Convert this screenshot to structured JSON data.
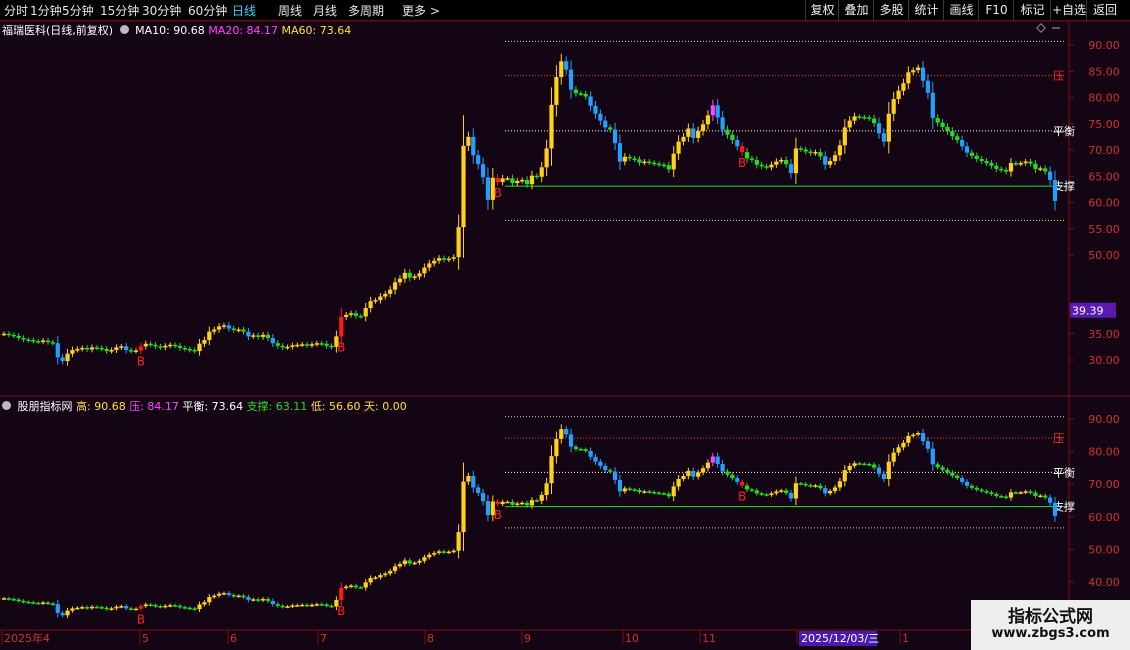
{
  "toolbar": {
    "periods": [
      "分时",
      "1分钟",
      "5分钟",
      "15分钟",
      "30分钟",
      "60分钟",
      "日线",
      "周线",
      "月线",
      "多周期",
      "更多 >"
    ],
    "active_period": "日线",
    "right_buttons": [
      "复权",
      "叠加",
      "多股",
      "统计",
      "画线",
      "F10",
      "标记",
      "+自选",
      "返回"
    ]
  },
  "main_panel": {
    "stock_name": "福瑞医科",
    "chart_desc": "(日线,前复权)",
    "ma10_label": "MA10: 90.68",
    "ma20_label": "MA20: 84.17",
    "ma60_label": "MA60: 73.64",
    "y_ticks": [
      "90.00",
      "85.00",
      "80.00",
      "75.00",
      "70.00",
      "65.00",
      "60.00",
      "55.00",
      "50.00",
      "35.00",
      "30.00"
    ],
    "price_tag": "39.39",
    "line_labels": {
      "pressure": "压",
      "balance": "平衡",
      "support": "支撑"
    },
    "signal_label": "B"
  },
  "sub_panel": {
    "name": "股朋指标网",
    "high_label": "高: 90.68",
    "pressure_label": "压: 84.17",
    "balance_label": "平衡: 73.64",
    "support_label": "支撑: 63.11",
    "low_label": "低: 56.60",
    "days_label": "天: 0.00",
    "y_ticks": [
      "90.00",
      "80.00",
      "70.00",
      "60.00",
      "50.00",
      "40.00"
    ]
  },
  "x_axis": {
    "labels": [
      "2025年4",
      "5",
      "6",
      "7",
      "8",
      "9",
      "10",
      "11",
      "1",
      "1"
    ],
    "cursor_date": "2025/12/03/三"
  },
  "watermark": {
    "line1": "指标公式网",
    "line2": "www.zbgs3.com"
  },
  "colors": {
    "up": "#ffd11a",
    "down": "#22dd22",
    "blue": "#22a0ff",
    "magenta": "#ff44ff",
    "red": "#ff1a1a",
    "bg": "#140514",
    "axis": "#7a1010"
  },
  "chart_data": {
    "type": "candlestick",
    "title": "福瑞医科 (日线,前复权)",
    "ylim_main": [
      26,
      92
    ],
    "ylim_sub": [
      36,
      92
    ],
    "levels": {
      "high": 90.68,
      "pressure": 84.17,
      "balance": 73.64,
      "support": 63.11,
      "low": 56.6
    },
    "closes": [
      35.0,
      34.8,
      34.6,
      34.2,
      33.9,
      33.8,
      33.6,
      33.5,
      33.7,
      33.4,
      33.2,
      30.5,
      29.8,
      31.2,
      31.9,
      32.1,
      32.3,
      32.0,
      32.4,
      32.3,
      32.1,
      31.7,
      31.9,
      32.4,
      32.6,
      31.9,
      31.7,
      31.8,
      32.6,
      33.1,
      32.9,
      32.6,
      32.4,
      32.7,
      32.9,
      32.7,
      32.3,
      32.1,
      31.9,
      31.7,
      33.1,
      33.8,
      35.4,
      35.8,
      36.4,
      36.6,
      36.0,
      35.7,
      35.8,
      35.4,
      34.5,
      34.7,
      34.4,
      34.8,
      34.2,
      33.2,
      32.7,
      32.4,
      32.5,
      32.8,
      32.9,
      33.0,
      32.8,
      33.0,
      33.2,
      33.1,
      32.7,
      32.5,
      34.5,
      38.2,
      38.6,
      38.9,
      38.4,
      38.3,
      39.9,
      41.2,
      41.4,
      42.1,
      42.6,
      43.4,
      44.8,
      45.5,
      46.6,
      45.7,
      45.9,
      46.5,
      47.6,
      48.4,
      48.9,
      49.4,
      49.1,
      49.3,
      49.6,
      55.3,
      70.8,
      72.5,
      69.0,
      67.3,
      64.8,
      60.5,
      64.7,
      63.9,
      64.6,
      64.6,
      63.7,
      64.1,
      64.3,
      63.5,
      65.1,
      64.9,
      66.7,
      70.3,
      78.6,
      83.9,
      86.9,
      85.3,
      81.5,
      80.8,
      80.7,
      80.2,
      78.4,
      76.9,
      75.6,
      74.3,
      73.9,
      71.3,
      67.8,
      68.7,
      68.4,
      68.2,
      67.6,
      67.8,
      67.6,
      67.4,
      67.2,
      67.1,
      66.3,
      69.3,
      71.6,
      72.5,
      74.1,
      72.3,
      73.6,
      74.9,
      76.6,
      78.5,
      76.2,
      73.9,
      72.9,
      71.9,
      70.7,
      69.6,
      68.4,
      68.1,
      67.2,
      66.9,
      66.7,
      67.2,
      67.8,
      68.1,
      67.3,
      65.6,
      70.3,
      70.1,
      69.7,
      69.4,
      69.6,
      68.8,
      67.2,
      67.9,
      69.0,
      70.9,
      74.3,
      75.6,
      76.4,
      76.3,
      76.2,
      76.0,
      75.1,
      73.2,
      71.6,
      76.9,
      79.7,
      81.3,
      82.7,
      84.8,
      85.2,
      85.7,
      83.2,
      80.9,
      76.1,
      75.2,
      74.4,
      73.6,
      72.6,
      71.9,
      70.7,
      69.5,
      68.9,
      68.3,
      67.9,
      67.5,
      67.0,
      66.4,
      66.2,
      65.9,
      67.5,
      67.4,
      67.5,
      67.8,
      67.4,
      66.4,
      66.5,
      65.9,
      64.3,
      60.3
    ],
    "b_signals": [
      28,
      69,
      101,
      151
    ]
  }
}
